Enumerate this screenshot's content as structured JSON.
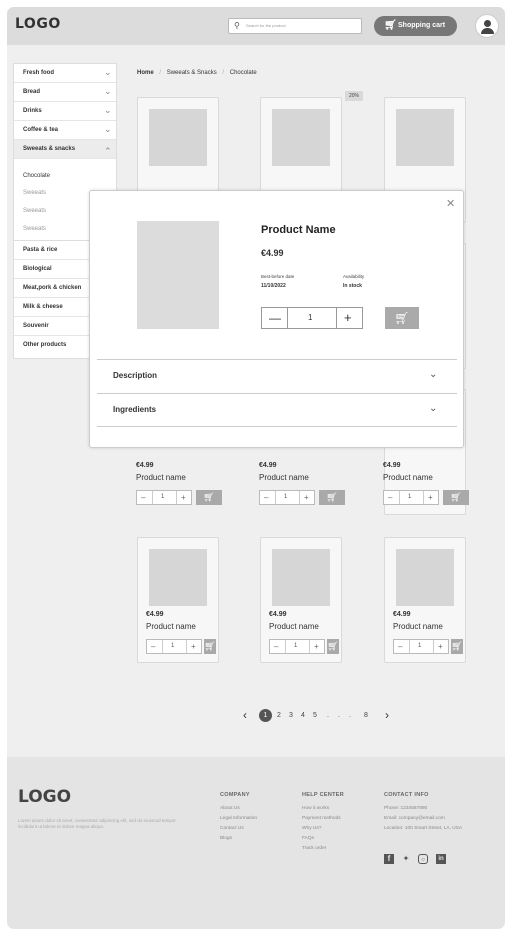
{
  "header": {
    "logo": "LOGO",
    "search_icon": "search-icon",
    "search_placeholder": "Search for the product",
    "cart_icon": "cart-icon",
    "cart_label": "Shopping cart",
    "avatar_icon": "user-icon"
  },
  "sidebar": {
    "items": [
      {
        "label": "Fresh food"
      },
      {
        "label": "Bread"
      },
      {
        "label": "Drinks"
      },
      {
        "label": "Coffee & tea"
      },
      {
        "label": "Sweeats & snacks"
      },
      {
        "label": "Pasta & rice"
      },
      {
        "label": "Biological"
      },
      {
        "label": "Meat,pork & chicken"
      },
      {
        "label": "Milk & cheese"
      },
      {
        "label": "Souvenir"
      },
      {
        "label": "Other products"
      }
    ],
    "subitems": [
      "Chocolate",
      "Sweeats",
      "Sweeats",
      "Sweeats"
    ]
  },
  "breadcrumb": {
    "home": "Home",
    "category": "Sweeats & Snacks",
    "current": "Chocolate",
    "separator": "/"
  },
  "badge": "20%",
  "products": [
    {
      "price": "€4.99",
      "name": "Product name",
      "qty": "1"
    },
    {
      "price": "€4.99",
      "name": "Product name",
      "qty": "1"
    },
    {
      "price": "€4.99",
      "name": "Product name",
      "qty": "1"
    },
    {
      "price": "€4.99",
      "name": "Product name",
      "qty": "1"
    },
    {
      "price": "€4.99",
      "name": "Product name",
      "qty": "1"
    },
    {
      "price": "€4.99",
      "name": "Product name",
      "qty": "1"
    }
  ],
  "pagination": {
    "prev": "‹",
    "next": "›",
    "current": "1",
    "pages": [
      "2",
      "3",
      "4",
      "5",
      ".",
      ".",
      ".",
      "8"
    ]
  },
  "footer": {
    "logo": "LOGO",
    "text": "Lorem ipsum dolor sit amet, consectetur adipiscing elit, sed do eiusmod tempor incididunt ut labore et dolore magna aliqua.",
    "company": {
      "title": "COMPANY",
      "links": [
        "About Us",
        "Legal Information",
        "Contact Us",
        "Blogs"
      ]
    },
    "help": {
      "title": "HELP CENTER",
      "links": [
        "How it works",
        "Payment methods",
        "Why Us?",
        "FAQs",
        "Track order"
      ]
    },
    "contact": {
      "title": "CONTACT INFO",
      "links": [
        "Phone: 1234567890",
        "Email: company@email.com",
        "Location: 100 Smart Street, LA, USA"
      ]
    },
    "social": [
      "facebook-icon",
      "twitter-icon",
      "instagram-icon",
      "linkedin-icon"
    ]
  },
  "modal": {
    "title": "Product Name",
    "price": "€4.99",
    "best_before_label": "Best-before date",
    "best_before_value": "11/10/2022",
    "availability_label": "Availability",
    "availability_value": "In stock",
    "qty": "1",
    "sections": [
      "Description",
      "Ingredients"
    ]
  }
}
